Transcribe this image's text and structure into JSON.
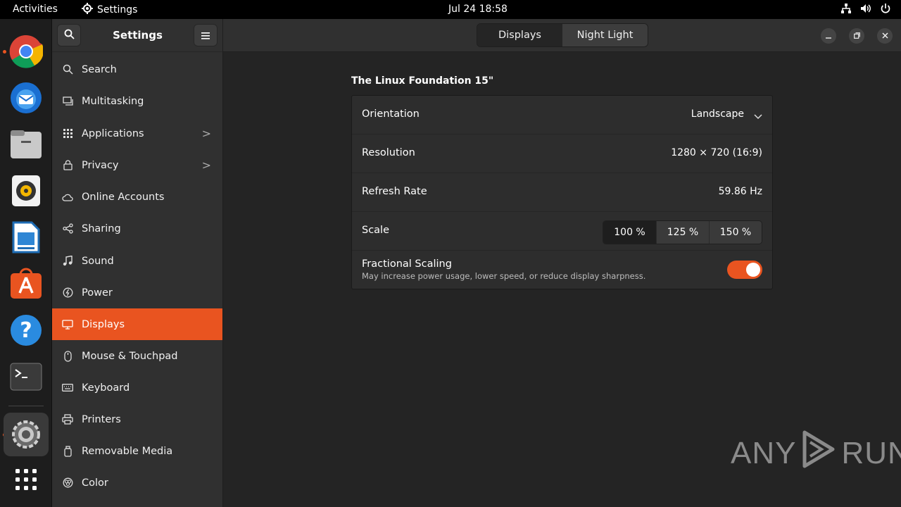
{
  "topbar": {
    "activities": "Activities",
    "app_name": "Settings",
    "clock": "Jul 24  18:58"
  },
  "dock": {
    "apps": [
      "chrome-icon",
      "thunderbird-icon",
      "files-icon",
      "rhythmbox-icon",
      "libreoffice-writer-icon",
      "app-center-icon",
      "help-icon",
      "terminal-icon",
      "settings-icon",
      "show-apps-icon"
    ]
  },
  "sidebar": {
    "title": "Settings",
    "items": [
      {
        "label": "Search",
        "icon": "search-icon"
      },
      {
        "label": "Multitasking",
        "icon": "multitasking-icon"
      },
      {
        "label": "Applications",
        "icon": "applications-icon",
        "chevron": ">"
      },
      {
        "label": "Privacy",
        "icon": "lock-icon",
        "chevron": ">"
      },
      {
        "label": "Online Accounts",
        "icon": "cloud-icon"
      },
      {
        "label": "Sharing",
        "icon": "share-icon"
      },
      {
        "label": "Sound",
        "icon": "music-note-icon"
      },
      {
        "label": "Power",
        "icon": "power-icon"
      },
      {
        "label": "Displays",
        "icon": "display-icon",
        "selected": true
      },
      {
        "label": "Mouse & Touchpad",
        "icon": "mouse-icon"
      },
      {
        "label": "Keyboard",
        "icon": "keyboard-icon"
      },
      {
        "label": "Printers",
        "icon": "printer-icon"
      },
      {
        "label": "Removable Media",
        "icon": "removable-media-icon"
      },
      {
        "label": "Color",
        "icon": "color-icon"
      }
    ]
  },
  "main": {
    "tabs": [
      {
        "label": "Displays",
        "active": true
      },
      {
        "label": "Night Light",
        "active": false
      }
    ],
    "monitor_title": "The Linux Foundation 15\"",
    "orientation": {
      "label": "Orientation",
      "value": "Landscape"
    },
    "resolution": {
      "label": "Resolution",
      "value": "1280 × 720 (16:9)"
    },
    "refresh_rate": {
      "label": "Refresh Rate",
      "value": "59.86 Hz"
    },
    "scale": {
      "label": "Scale",
      "options": [
        "100 %",
        "125 %",
        "150 %"
      ],
      "selected": "100 %"
    },
    "fractional_scaling": {
      "label": "Fractional Scaling",
      "description": "May increase power usage, lower speed, or reduce display sharpness.",
      "enabled": true
    }
  },
  "watermark": {
    "left": "ANY",
    "right": "RUN"
  },
  "colors": {
    "accent": "#e95420"
  }
}
